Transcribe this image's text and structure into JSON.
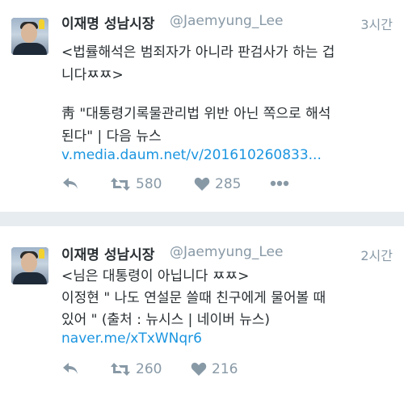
{
  "tweets": [
    {
      "author": "이재명 성남시장",
      "handle": "@Jaemyung_Lee",
      "time": "3시간",
      "lines": [
        "<법률해석은 범죄자가 아니라 판검사가 하는 겁",
        "니다ㅉㅉ>",
        "",
        "靑 \"대통령기록물관리법 위반 아닌 쪽으로 해석",
        "된다\" | 다음 뉴스"
      ],
      "link": "v.media.daum.net/v/201610260833...",
      "retweets": "580",
      "likes": "285",
      "icons": [
        "reply-icon",
        "retweet-icon",
        "heart-icon",
        "more-icon"
      ]
    },
    {
      "author": "이재명 성남시장",
      "handle": "@Jaemyung_Lee",
      "time": "2시간",
      "lines": [
        "<님은 대통령이 아닙니다 ㅉㅉ>",
        "이정현 \" 나도 연설문 쓸때 친구에게 물어볼 때",
        "있어 \" (출처 : 뉴시스 | 네이버 뉴스)"
      ],
      "link": "naver.me/xTxWNqr6",
      "retweets": "260",
      "likes": "216",
      "icons": [
        "reply-icon",
        "retweet-icon",
        "heart-icon",
        "more-icon"
      ]
    }
  ],
  "colors": {
    "background": "#e6ecf0",
    "text": "#292f33",
    "muted": "#8899a6",
    "link": "#1b95e0",
    "ribbon": "#f3d230"
  }
}
